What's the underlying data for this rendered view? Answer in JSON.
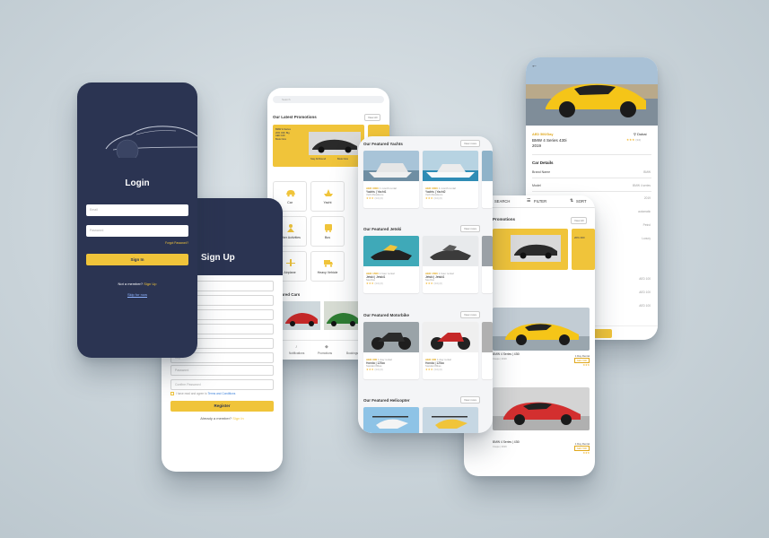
{
  "login": {
    "title": "Login",
    "email_placeholder": "Email",
    "password_placeholder": "Password",
    "forgot": "Forgot Password?",
    "signin_label": "Sign In",
    "not_member": "Not a member?",
    "signup_link": "Sign Up",
    "skip": "Skip for now"
  },
  "signup": {
    "title": "Sign Up",
    "fields": [
      "First Name",
      "Last Name",
      "Email",
      "Phone",
      "Country",
      "City",
      "Password",
      "Confirm Password"
    ],
    "terms_prefix": "I have read and agree to",
    "terms_link": "Terms and Conditions",
    "register_label": "Register",
    "already": "Already a member?",
    "signin_link": "Sign In"
  },
  "home": {
    "search_placeholder": "Search",
    "promotions_title": "Our Latest Promotions",
    "view_all": "View All",
    "promo_text": "BMW & Series\n20% OFF Big\nAED 449\nBook Now",
    "promo_cta1": "Stay All Round",
    "promo_cta2": "Book Now",
    "categories": [
      {
        "label": "Car",
        "icon": "car-icon"
      },
      {
        "label": "Yacht",
        "icon": "yacht-icon"
      },
      {
        "label": "Other Activities",
        "icon": "activities-icon"
      },
      {
        "label": "Bus",
        "icon": "bus-icon"
      },
      {
        "label": "Airplane",
        "icon": "airplane-icon"
      },
      {
        "label": "Heavy Vehicle",
        "icon": "truck-icon"
      }
    ],
    "featured_cars": "Featured Cars",
    "nav": [
      "Notifications",
      "Promotions",
      "Bookings"
    ]
  },
  "listing": {
    "sections": [
      {
        "title": "Our Featured Yachts",
        "view": "View more",
        "items": [
          {
            "price": "AED 3000",
            "rent": "1 month rental",
            "name": "Yachts | Yacht1",
            "sub": "Yacht Residence",
            "stars": "★★★",
            "rating": "(3.0) (0)"
          },
          {
            "price": "AED 3000",
            "rent": "1 month rental",
            "name": "Yachts | Yacht2",
            "sub": "Yacht Residence",
            "stars": "★★★",
            "rating": "(3.0) (0)"
          }
        ]
      },
      {
        "title": "Our Featured Jetski",
        "view": "View more",
        "items": [
          {
            "price": "AED 1500",
            "rent": "1 hour rental",
            "name": "Jetski | Jetski1",
            "sub": "Sea Doo",
            "stars": "★★★",
            "rating": "(3.0) (0)"
          },
          {
            "price": "AED 1500",
            "rent": "1 hour rental",
            "name": "Jetski | Jetski1",
            "sub": "Sea Doo",
            "stars": "★★★",
            "rating": "(3.0) (0)"
          }
        ]
      },
      {
        "title": "Our Featured Motorbike",
        "view": "View more",
        "items": [
          {
            "price": "AED 300",
            "rent": "1 day rental",
            "name": "Honda | 125cc",
            "sub": "Standard Bikes",
            "stars": "★★★",
            "rating": "(3.0) (0)"
          },
          {
            "price": "AED 300",
            "rent": "1 day rental",
            "name": "Honda | 125cc",
            "sub": "Standard Bikes",
            "stars": "★★★",
            "rating": "(3.0) (0)"
          }
        ]
      },
      {
        "title": "Our Featured Helicopter",
        "view": "View more",
        "items": []
      }
    ]
  },
  "results": {
    "search": "SEARCH",
    "filter": "FILTER",
    "sort": "SORT",
    "promotions_title": "Promotions",
    "view_all": "View All",
    "promo_text": "20% OFF",
    "results": [
      {
        "name": "BMW 4 Series | 430i",
        "sub": "Coupe | 2019",
        "rent": "1 Day Rental",
        "price": "AED 500",
        "stars": "★★★"
      },
      {
        "name": "BMW 4 Series | 430i",
        "sub": "Coupe | 2019",
        "rent": "1 Day Rental",
        "price": "AED 500",
        "stars": "★★★"
      }
    ]
  },
  "detail": {
    "back": "←",
    "price": "AED 500/Day",
    "name": "BMW 4 Series 430i",
    "year": "2019",
    "location": "Dubai",
    "stars": "★★★",
    "rating": "(3.0)",
    "details_title": "Car Details",
    "rows": [
      {
        "label": "Brand Name",
        "value": "BMW"
      },
      {
        "label": "Model",
        "value": "BMW 4 series"
      },
      {
        "label": "",
        "value": "2019"
      },
      {
        "label": "",
        "value": "automatic"
      },
      {
        "label": "",
        "value": "Petrol"
      },
      {
        "label": "",
        "value": "Luxury"
      },
      {
        "label": "",
        "value": "AED 100"
      },
      {
        "label": "",
        "value": "AED 100"
      },
      {
        "label": "",
        "value": "AED 100"
      }
    ]
  },
  "colors": {
    "navy": "#2b3452",
    "gold": "#f0c43a",
    "background": "#c9d3d9"
  }
}
